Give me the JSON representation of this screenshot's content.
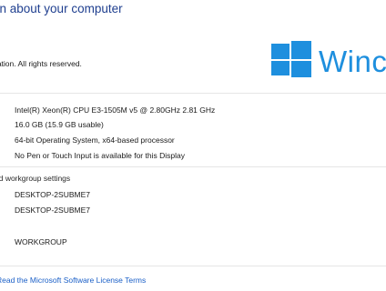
{
  "header": {
    "title": "on about your computer"
  },
  "edition": {
    "copyright": "ration. All rights reserved.",
    "logo_text": "Winc",
    "logo_color": "#1e8fde"
  },
  "system": {
    "processor_value": "Intel(R) Xeon(R) CPU E3-1505M v5 @ 2.80GHz   2.81 GHz",
    "memory_label": ":",
    "memory_value": "16.0 GB (15.9 GB usable)",
    "type_value": "64-bit Operating System, x64-based processor",
    "pen_value": "No Pen or Touch Input is available for this Display"
  },
  "computer_name_section": {
    "title": "nd workgroup settings",
    "computer_name": "DESKTOP-2SUBME7",
    "full_computer_name": "DESKTOP-2SUBME7",
    "workgroup": "WORKGROUP"
  },
  "footer": {
    "license_link": "Read the Microsoft Software License Terms"
  },
  "colors": {
    "title": "#1f3f8f",
    "link": "#1a5fc7",
    "divider": "#e6e6e6"
  }
}
